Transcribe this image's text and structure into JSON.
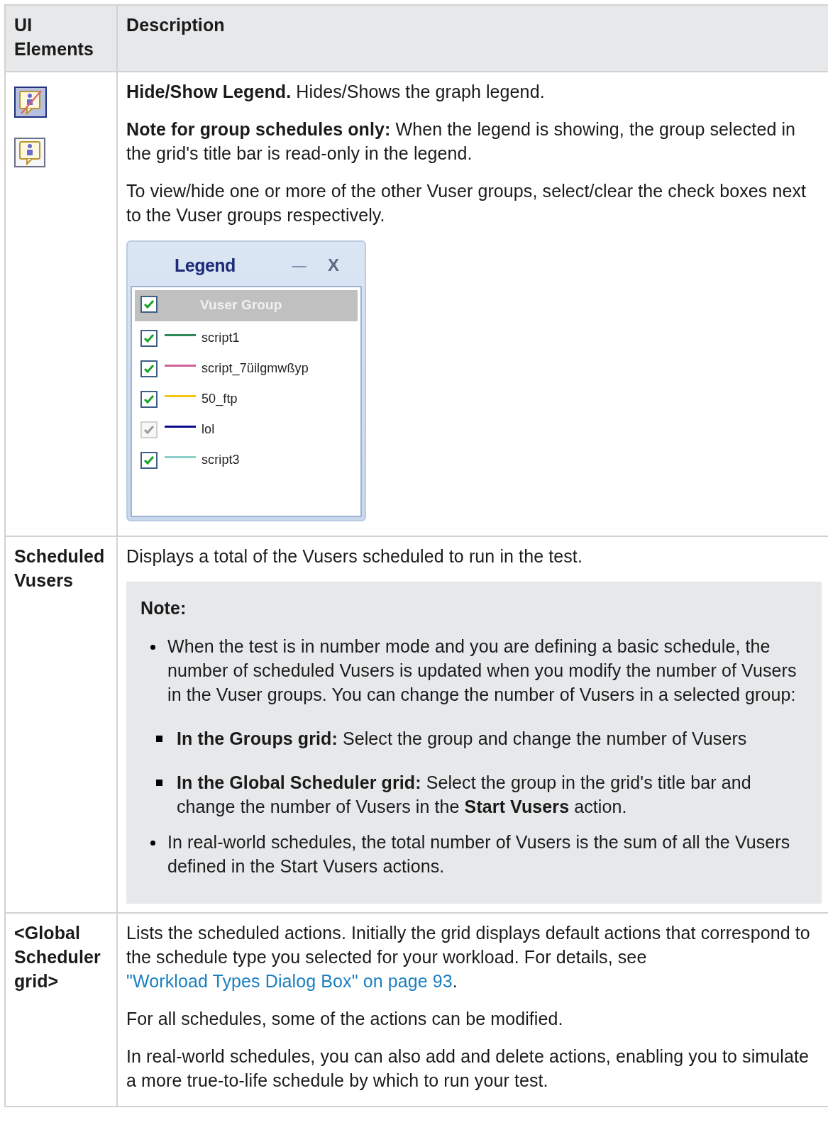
{
  "table": {
    "columns": [
      "UI Elements",
      "Description"
    ],
    "rows": [
      {
        "kind": "icons",
        "blocks": [
          {
            "kind": "paragraph",
            "text": "**Hide/Show Legend.** Hides/Shows the graph legend."
          },
          {
            "kind": "paragraph",
            "text": "**Note for group schedules only:** When the legend is showing, the group selected in the grid's title bar is read-only in the legend."
          },
          {
            "kind": "paragraph",
            "text": "To view/hide one or more of the other Vuser groups, select/clear the check boxes next to the Vuser groups respectively."
          },
          {
            "kind": "legend",
            "title": "Legend",
            "minimize": "—",
            "close": "X",
            "header": {
              "label": "Vuser Group",
              "checked": true
            },
            "items": [
              {
                "label": "script1",
                "color": "#2e8b57",
                "checked": true,
                "disabled": false
              },
              {
                "label": "script_7üilgmwßyp",
                "color": "#d0609a",
                "checked": true,
                "disabled": false
              },
              {
                "label": "50_ftp",
                "color": "#f5c518",
                "checked": true,
                "disabled": false
              },
              {
                "label": "lol",
                "color": "#0a0a8c",
                "checked": true,
                "disabled": true
              },
              {
                "label": "script3",
                "color": "#8ccfc8",
                "checked": true,
                "disabled": false
              }
            ]
          }
        ]
      },
      {
        "kind": "text",
        "label": "Scheduled Vusers",
        "blocks": [
          {
            "kind": "paragraph",
            "text": "Displays a total of the Vusers scheduled to run in the test."
          },
          {
            "kind": "note",
            "title": "Note:",
            "items": [
              {
                "text": "When the test is in number mode and you are defining a basic schedule, the number of scheduled Vusers is updated when you modify the number of Vusers in the Vuser groups. You can change the number of Vusers in a selected group:",
                "children": [
                  {
                    "text": "**In the Groups grid:** Select the group and change the number of Vusers"
                  },
                  {
                    "text": "**In the Global Scheduler grid:** Select the group in the grid's title bar and change the number of Vusers in the **Start Vusers** action."
                  }
                ]
              },
              {
                "text": "In real-world schedules, the total number of Vusers is the sum of all the Vusers defined in the Start Vusers actions."
              }
            ]
          }
        ]
      },
      {
        "kind": "text",
        "label": "<Global Scheduler grid>",
        "blocks": [
          {
            "kind": "link_paragraph",
            "before": "Lists the scheduled actions. Initially the grid displays default actions that correspond to the schedule type you selected for your workload. For details, see ",
            "link": "\"Workload Types Dialog Box\" on page 93",
            "after": "."
          },
          {
            "kind": "paragraph",
            "text": "For all schedules, some of the actions can be modified."
          },
          {
            "kind": "paragraph",
            "text": "In real-world schedules, you can also add and delete actions, enabling you to simulate a more true-to-life schedule by which to run your test."
          }
        ]
      }
    ]
  }
}
